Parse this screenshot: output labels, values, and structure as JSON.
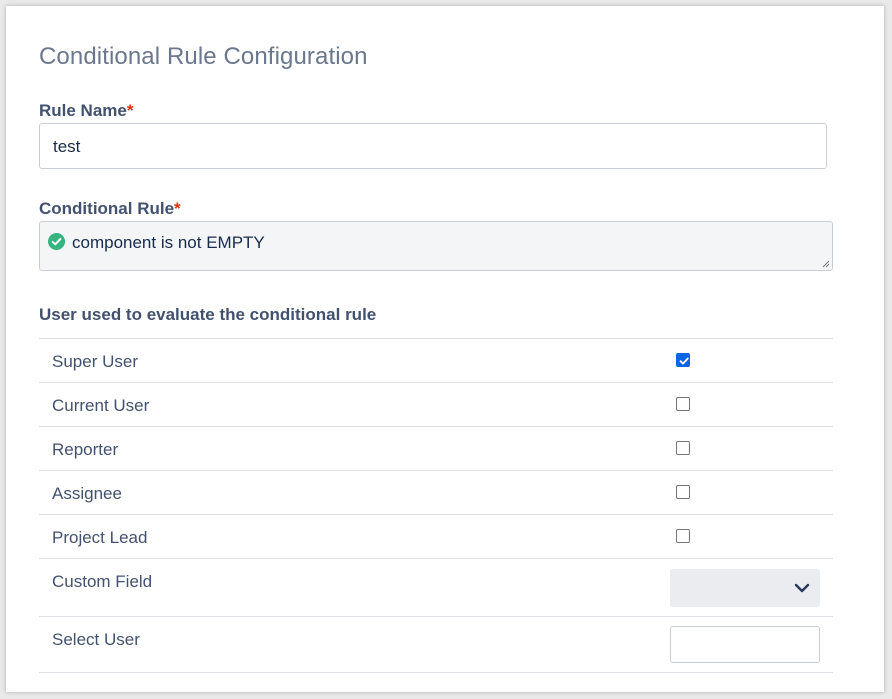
{
  "title": "Conditional Rule Configuration",
  "rule_name": {
    "label": "Rule Name",
    "required_mark": "*",
    "value": "test"
  },
  "conditional_rule": {
    "label": "Conditional Rule",
    "required_mark": "*",
    "value": "component is not EMPTY",
    "status_icon": "check-circle-icon"
  },
  "users_section": {
    "label": "User used to evaluate the conditional rule",
    "rows": [
      {
        "label": "Super User",
        "checked": true
      },
      {
        "label": "Current User",
        "checked": false
      },
      {
        "label": "Reporter",
        "checked": false
      },
      {
        "label": "Assignee",
        "checked": false
      },
      {
        "label": "Project Lead",
        "checked": false
      }
    ],
    "custom_field": {
      "label": "Custom Field",
      "value": ""
    },
    "select_user": {
      "label": "Select User",
      "value": ""
    }
  },
  "colors": {
    "accent": "#0c66e4",
    "success": "#36b37e",
    "required": "#de350b"
  }
}
